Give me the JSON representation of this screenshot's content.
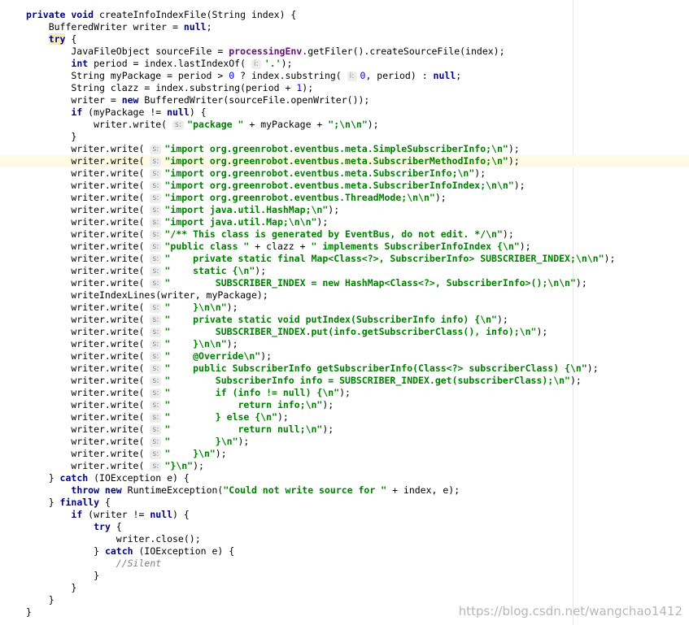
{
  "editor": {
    "highlighted_line": 12,
    "colors": {
      "background": "#ffffff",
      "keyword": "#000080",
      "string": "#008000",
      "number": "#0000ff",
      "field": "#660e7a",
      "comment": "#808080",
      "hint_bg": "#ededed",
      "hint_text": "#959595",
      "current_line": "#fffae3"
    },
    "lines": [
      [
        {
          "t": "kw",
          "v": "private void "
        },
        {
          "t": "p",
          "v": "createInfoIndexFile(String index) {"
        }
      ],
      [
        {
          "t": "p",
          "v": "    BufferedWriter writer = "
        },
        {
          "t": "kw",
          "v": "null"
        },
        {
          "t": "p",
          "v": ";"
        }
      ],
      [
        {
          "t": "p",
          "v": "    "
        },
        {
          "t": "kwm",
          "v": "try"
        },
        {
          "t": "p",
          "v": " {"
        }
      ],
      [
        {
          "t": "p",
          "v": "        JavaFileObject sourceFile = "
        },
        {
          "t": "fld",
          "v": "processingEnv"
        },
        {
          "t": "p",
          "v": ".getFiler().createSourceFile(index);"
        }
      ],
      [
        {
          "t": "p",
          "v": "        "
        },
        {
          "t": "kw",
          "v": "int "
        },
        {
          "t": "p",
          "v": "period = index.lastIndexOf( "
        },
        {
          "t": "hint",
          "v": "i:"
        },
        {
          "t": "str",
          "v": "'.'"
        },
        {
          "t": "p",
          "v": ");"
        }
      ],
      [
        {
          "t": "p",
          "v": "        String myPackage = period > "
        },
        {
          "t": "num",
          "v": "0"
        },
        {
          "t": "p",
          "v": " ? index.substring( "
        },
        {
          "t": "hint",
          "v": "i:"
        },
        {
          "t": "num",
          "v": "0"
        },
        {
          "t": "p",
          "v": ", period) : "
        },
        {
          "t": "kw",
          "v": "null"
        },
        {
          "t": "p",
          "v": ";"
        }
      ],
      [
        {
          "t": "p",
          "v": "        String clazz = index.substring(period + "
        },
        {
          "t": "num",
          "v": "1"
        },
        {
          "t": "p",
          "v": ");"
        }
      ],
      [
        {
          "t": "p",
          "v": "        writer = "
        },
        {
          "t": "kw",
          "v": "new "
        },
        {
          "t": "p",
          "v": "BufferedWriter(sourceFile.openWriter());"
        }
      ],
      [
        {
          "t": "p",
          "v": "        "
        },
        {
          "t": "kw",
          "v": "if "
        },
        {
          "t": "p",
          "v": "(myPackage != "
        },
        {
          "t": "kw",
          "v": "null"
        },
        {
          "t": "p",
          "v": ") {"
        }
      ],
      [
        {
          "t": "p",
          "v": "            writer.write( "
        },
        {
          "t": "hint",
          "v": "s:"
        },
        {
          "t": "str",
          "v": "\"package \""
        },
        {
          "t": "p",
          "v": " + myPackage + "
        },
        {
          "t": "str",
          "v": "\";\\n\\n\""
        },
        {
          "t": "p",
          "v": ");"
        }
      ],
      [
        {
          "t": "p",
          "v": "        }"
        }
      ],
      [
        {
          "t": "p",
          "v": "        writer.write( "
        },
        {
          "t": "hint",
          "v": "s:"
        },
        {
          "t": "str",
          "v": "\"import org.greenrobot.eventbus.meta.SimpleSubscriberInfo;\\n\""
        },
        {
          "t": "p",
          "v": ");"
        }
      ],
      [
        {
          "t": "p",
          "v": "        writer.write( "
        },
        {
          "t": "hint",
          "v": "s:"
        },
        {
          "t": "str",
          "v": "\"import org.greenrobot.eventbus.meta.SubscriberMethodInfo;\\n\""
        },
        {
          "t": "p",
          "v": ");"
        }
      ],
      [
        {
          "t": "p",
          "v": "        writer.write( "
        },
        {
          "t": "hint",
          "v": "s:"
        },
        {
          "t": "str",
          "v": "\"import org.greenrobot.eventbus.meta.SubscriberInfo;\\n\""
        },
        {
          "t": "p",
          "v": ");"
        }
      ],
      [
        {
          "t": "p",
          "v": "        writer.write( "
        },
        {
          "t": "hint",
          "v": "s:"
        },
        {
          "t": "str",
          "v": "\"import org.greenrobot.eventbus.meta.SubscriberInfoIndex;\\n\\n\""
        },
        {
          "t": "p",
          "v": ");"
        }
      ],
      [
        {
          "t": "p",
          "v": "        writer.write( "
        },
        {
          "t": "hint",
          "v": "s:"
        },
        {
          "t": "str",
          "v": "\"import org.greenrobot.eventbus.ThreadMode;\\n\\n\""
        },
        {
          "t": "p",
          "v": ");"
        }
      ],
      [
        {
          "t": "p",
          "v": "        writer.write( "
        },
        {
          "t": "hint",
          "v": "s:"
        },
        {
          "t": "str",
          "v": "\"import java.util.HashMap;\\n\""
        },
        {
          "t": "p",
          "v": ");"
        }
      ],
      [
        {
          "t": "p",
          "v": "        writer.write( "
        },
        {
          "t": "hint",
          "v": "s:"
        },
        {
          "t": "str",
          "v": "\"import java.util.Map;\\n\\n\""
        },
        {
          "t": "p",
          "v": ");"
        }
      ],
      [
        {
          "t": "p",
          "v": "        writer.write( "
        },
        {
          "t": "hint",
          "v": "s:"
        },
        {
          "t": "str",
          "v": "\"/** This class is generated by EventBus, do not edit. */\\n\""
        },
        {
          "t": "p",
          "v": ");"
        }
      ],
      [
        {
          "t": "p",
          "v": "        writer.write( "
        },
        {
          "t": "hint",
          "v": "s:"
        },
        {
          "t": "str",
          "v": "\"public class \""
        },
        {
          "t": "p",
          "v": " + clazz + "
        },
        {
          "t": "str",
          "v": "\" implements SubscriberInfoIndex {\\n\""
        },
        {
          "t": "p",
          "v": ");"
        }
      ],
      [
        {
          "t": "p",
          "v": "        writer.write( "
        },
        {
          "t": "hint",
          "v": "s:"
        },
        {
          "t": "str",
          "v": "\"    private static final Map<Class<?>, SubscriberInfo> SUBSCRIBER_INDEX;\\n\\n\""
        },
        {
          "t": "p",
          "v": ");"
        }
      ],
      [
        {
          "t": "p",
          "v": "        writer.write( "
        },
        {
          "t": "hint",
          "v": "s:"
        },
        {
          "t": "str",
          "v": "\"    static {\\n\""
        },
        {
          "t": "p",
          "v": ");"
        }
      ],
      [
        {
          "t": "p",
          "v": "        writer.write( "
        },
        {
          "t": "hint",
          "v": "s:"
        },
        {
          "t": "str",
          "v": "\"        SUBSCRIBER_INDEX = new HashMap<Class<?>, SubscriberInfo>();\\n\\n\""
        },
        {
          "t": "p",
          "v": ");"
        }
      ],
      [
        {
          "t": "p",
          "v": "        writeIndexLines(writer, myPackage);"
        }
      ],
      [
        {
          "t": "p",
          "v": "        writer.write( "
        },
        {
          "t": "hint",
          "v": "s:"
        },
        {
          "t": "str",
          "v": "\"    }\\n\\n\""
        },
        {
          "t": "p",
          "v": ");"
        }
      ],
      [
        {
          "t": "p",
          "v": "        writer.write( "
        },
        {
          "t": "hint",
          "v": "s:"
        },
        {
          "t": "str",
          "v": "\"    private static void putIndex(SubscriberInfo info) {\\n\""
        },
        {
          "t": "p",
          "v": ");"
        }
      ],
      [
        {
          "t": "p",
          "v": "        writer.write( "
        },
        {
          "t": "hint",
          "v": "s:"
        },
        {
          "t": "str",
          "v": "\"        SUBSCRIBER_INDEX.put(info.getSubscriberClass(), info);\\n\""
        },
        {
          "t": "p",
          "v": ");"
        }
      ],
      [
        {
          "t": "p",
          "v": "        writer.write( "
        },
        {
          "t": "hint",
          "v": "s:"
        },
        {
          "t": "str",
          "v": "\"    }\\n\\n\""
        },
        {
          "t": "p",
          "v": ");"
        }
      ],
      [
        {
          "t": "p",
          "v": "        writer.write( "
        },
        {
          "t": "hint",
          "v": "s:"
        },
        {
          "t": "str",
          "v": "\"    @Override\\n\""
        },
        {
          "t": "p",
          "v": ");"
        }
      ],
      [
        {
          "t": "p",
          "v": "        writer.write( "
        },
        {
          "t": "hint",
          "v": "s:"
        },
        {
          "t": "str",
          "v": "\"    public SubscriberInfo getSubscriberInfo(Class<?> subscriberClass) {\\n\""
        },
        {
          "t": "p",
          "v": ");"
        }
      ],
      [
        {
          "t": "p",
          "v": "        writer.write( "
        },
        {
          "t": "hint",
          "v": "s:"
        },
        {
          "t": "str",
          "v": "\"        SubscriberInfo info = SUBSCRIBER_INDEX.get(subscriberClass);\\n\""
        },
        {
          "t": "p",
          "v": ");"
        }
      ],
      [
        {
          "t": "p",
          "v": "        writer.write( "
        },
        {
          "t": "hint",
          "v": "s:"
        },
        {
          "t": "str",
          "v": "\"        if (info != null) {\\n\""
        },
        {
          "t": "p",
          "v": ");"
        }
      ],
      [
        {
          "t": "p",
          "v": "        writer.write( "
        },
        {
          "t": "hint",
          "v": "s:"
        },
        {
          "t": "str",
          "v": "\"            return info;\\n\""
        },
        {
          "t": "p",
          "v": ");"
        }
      ],
      [
        {
          "t": "p",
          "v": "        writer.write( "
        },
        {
          "t": "hint",
          "v": "s:"
        },
        {
          "t": "str",
          "v": "\"        } else {\\n\""
        },
        {
          "t": "p",
          "v": ");"
        }
      ],
      [
        {
          "t": "p",
          "v": "        writer.write( "
        },
        {
          "t": "hint",
          "v": "s:"
        },
        {
          "t": "str",
          "v": "\"            return null;\\n\""
        },
        {
          "t": "p",
          "v": ");"
        }
      ],
      [
        {
          "t": "p",
          "v": "        writer.write( "
        },
        {
          "t": "hint",
          "v": "s:"
        },
        {
          "t": "str",
          "v": "\"        }\\n\""
        },
        {
          "t": "p",
          "v": ");"
        }
      ],
      [
        {
          "t": "p",
          "v": "        writer.write( "
        },
        {
          "t": "hint",
          "v": "s:"
        },
        {
          "t": "str",
          "v": "\"    }\\n\""
        },
        {
          "t": "p",
          "v": ");"
        }
      ],
      [
        {
          "t": "p",
          "v": "        writer.write( "
        },
        {
          "t": "hint",
          "v": "s:"
        },
        {
          "t": "str",
          "v": "\"}\\n\""
        },
        {
          "t": "p",
          "v": ");"
        }
      ],
      [
        {
          "t": "p",
          "v": "    } "
        },
        {
          "t": "kw",
          "v": "catch "
        },
        {
          "t": "p",
          "v": "(IOException e) {"
        }
      ],
      [
        {
          "t": "p",
          "v": "        "
        },
        {
          "t": "kw",
          "v": "throw new "
        },
        {
          "t": "p",
          "v": "RuntimeException("
        },
        {
          "t": "str",
          "v": "\"Could not write source for \""
        },
        {
          "t": "p",
          "v": " + index, e);"
        }
      ],
      [
        {
          "t": "p",
          "v": "    } "
        },
        {
          "t": "kw",
          "v": "finally "
        },
        {
          "t": "p",
          "v": "{"
        }
      ],
      [
        {
          "t": "p",
          "v": "        "
        },
        {
          "t": "kw",
          "v": "if "
        },
        {
          "t": "p",
          "v": "(writer != "
        },
        {
          "t": "kw",
          "v": "null"
        },
        {
          "t": "p",
          "v": ") {"
        }
      ],
      [
        {
          "t": "p",
          "v": "            "
        },
        {
          "t": "kw",
          "v": "try "
        },
        {
          "t": "p",
          "v": "{"
        }
      ],
      [
        {
          "t": "p",
          "v": "                writer.close();"
        }
      ],
      [
        {
          "t": "p",
          "v": "            } "
        },
        {
          "t": "kw",
          "v": "catch "
        },
        {
          "t": "p",
          "v": "(IOException e) {"
        }
      ],
      [
        {
          "t": "p",
          "v": "                "
        },
        {
          "t": "cm",
          "v": "//Silent"
        }
      ],
      [
        {
          "t": "p",
          "v": "            }"
        }
      ],
      [
        {
          "t": "p",
          "v": "        }"
        }
      ],
      [
        {
          "t": "p",
          "v": "    }"
        }
      ],
      [
        {
          "t": "p",
          "v": "}"
        }
      ]
    ]
  },
  "watermark": "https://blog.csdn.net/wangchao1412"
}
